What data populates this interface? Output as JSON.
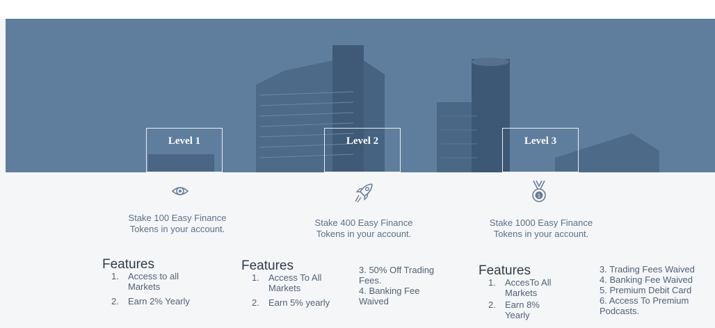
{
  "tiers": [
    {
      "level": "Level 1",
      "icon": "eye-icon",
      "description": "Stake 100 Easy Finance Tokens in your account.",
      "features_title": "Features",
      "features": [
        {
          "num": "1.",
          "text": "Access to all Markets"
        },
        {
          "num": "2.",
          "text": "Earn 2% Yearly"
        }
      ],
      "extra": []
    },
    {
      "level": "Level 2",
      "icon": "rocket-icon",
      "description": "Stake 400 Easy Finance Tokens in your account.",
      "features_title": "Features",
      "features": [
        {
          "num": "1.",
          "text": "Access To All Markets"
        },
        {
          "num": "2.",
          "text": "Earn 5% yearly"
        }
      ],
      "extra": [
        "3. 50% Off Trading Fees.",
        "4. Banking Fee Waived"
      ]
    },
    {
      "level": "Level 3",
      "icon": "medal-icon",
      "description": "Stake 1000 Easy Finance Tokens in your account.",
      "features_title": "Features",
      "features": [
        {
          "num": "1.",
          "text": "AccesTo All Markets"
        },
        {
          "num": "2.",
          "text": "Earn 8% Yearly"
        }
      ],
      "extra": [
        "3. Trading Fees Waived",
        "4. Banking Fee Waived",
        "5. Premium Debit Card",
        "6. Access To Premium Podcasts."
      ]
    }
  ],
  "colors": {
    "hero_overlay": "#5b7b9b",
    "text": "#4f6276",
    "heading": "#2f3b47"
  }
}
